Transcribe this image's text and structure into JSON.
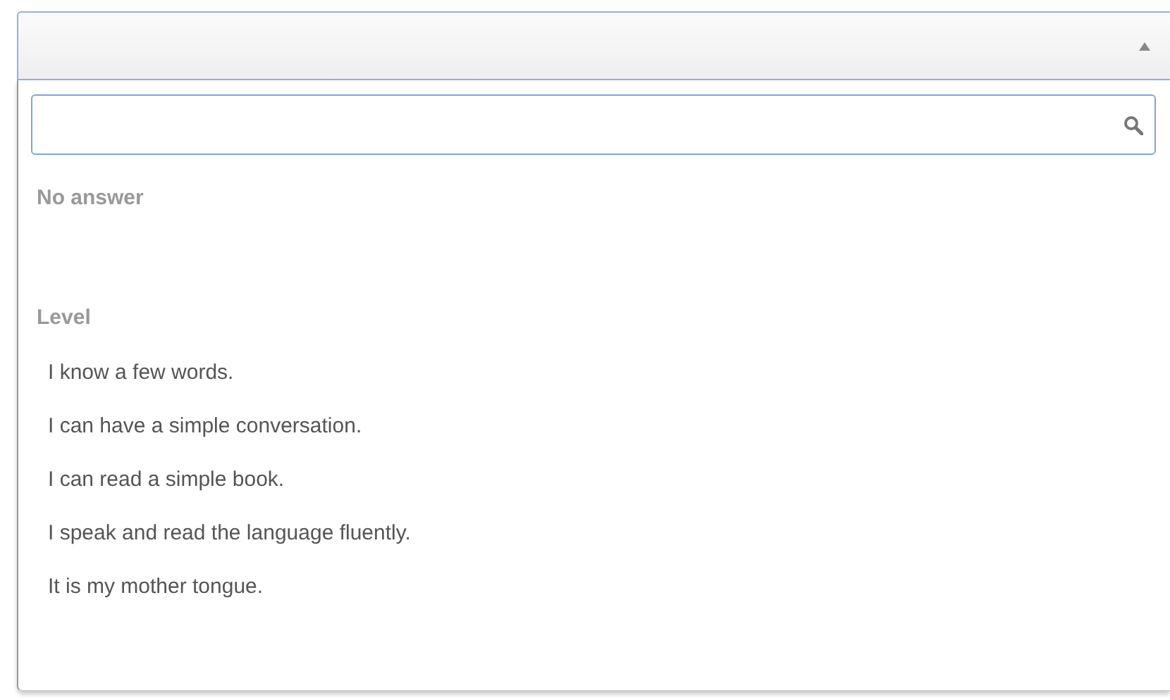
{
  "select": {
    "expanded": true
  },
  "groups": [
    {
      "label": "No answer"
    },
    {
      "label": "Level",
      "options": [
        "I know a few words.",
        "I can have a simple conversation.",
        "I can read a simple book.",
        "I speak and read the language fluently.",
        "It is my mother tongue."
      ]
    }
  ]
}
